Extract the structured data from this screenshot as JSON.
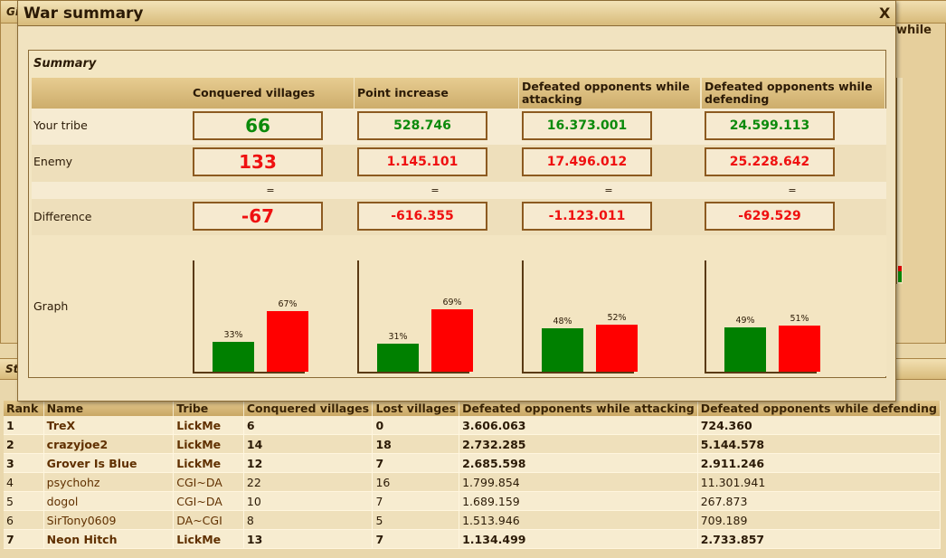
{
  "background_window": {
    "title_fragment": "Gi",
    "header_fragment": "while"
  },
  "stats_panel": {
    "title_fragment": "St",
    "columns": [
      "Rank",
      "Name",
      "Tribe",
      "Conquered villages",
      "Lost villages",
      "Defeated opponents while attacking",
      "Defeated opponents while defending"
    ],
    "rows": [
      {
        "rank": "1",
        "name": "TreX",
        "tribe": "LickMe",
        "conquered": "6",
        "lost": "0",
        "attacking": "3.606.063",
        "defending": "724.360",
        "bold": true
      },
      {
        "rank": "2",
        "name": "crazyjoe2",
        "tribe": "LickMe",
        "conquered": "14",
        "lost": "18",
        "attacking": "2.732.285",
        "defending": "5.144.578",
        "bold": true
      },
      {
        "rank": "3",
        "name": "Grover Is Blue",
        "tribe": "LickMe",
        "conquered": "12",
        "lost": "7",
        "attacking": "2.685.598",
        "defending": "2.911.246",
        "bold": true
      },
      {
        "rank": "4",
        "name": "psychohz",
        "tribe": "CGI~DA",
        "conquered": "22",
        "lost": "16",
        "attacking": "1.799.854",
        "defending": "11.301.941",
        "bold": false
      },
      {
        "rank": "5",
        "name": "dogol",
        "tribe": "CGI~DA",
        "conquered": "10",
        "lost": "7",
        "attacking": "1.689.159",
        "defending": "267.873",
        "bold": false
      },
      {
        "rank": "6",
        "name": "SirTony0609",
        "tribe": "DA~CGI",
        "conquered": "8",
        "lost": "5",
        "attacking": "1.513.946",
        "defending": "709.189",
        "bold": false
      },
      {
        "rank": "7",
        "name": "Neon Hitch",
        "tribe": "LickMe",
        "conquered": "13",
        "lost": "7",
        "attacking": "1.134.499",
        "defending": "2.733.857",
        "bold": true
      }
    ]
  },
  "dialog": {
    "title": "War summary",
    "close_label": "X",
    "summary_label": "Summary",
    "columns": [
      "Conquered villages",
      "Point increase",
      "Defeated opponents while attacking",
      "Defeated opponents while defending"
    ],
    "row_labels": {
      "your_tribe": "Your tribe",
      "enemy": "Enemy",
      "difference": "Difference",
      "graph": "Graph"
    },
    "equals_sign": "=",
    "your_tribe": [
      "66",
      "528.746",
      "16.373.001",
      "24.599.113"
    ],
    "enemy": [
      "133",
      "1.145.101",
      "17.496.012",
      "25.228.642"
    ],
    "difference": [
      "-67",
      "-616.355",
      "-1.123.011",
      "-629.529"
    ],
    "colors": {
      "your_tribe": "#008000",
      "enemy": "#ff0000"
    }
  },
  "chart_data": [
    {
      "type": "bar",
      "categories": [
        "Your tribe",
        "Enemy"
      ],
      "values": [
        33,
        67
      ],
      "data_labels": [
        "33%",
        "67%"
      ],
      "unit": "%",
      "ylim": [
        0,
        100
      ]
    },
    {
      "type": "bar",
      "categories": [
        "Your tribe",
        "Enemy"
      ],
      "values": [
        31,
        69
      ],
      "data_labels": [
        "31%",
        "69%"
      ],
      "unit": "%",
      "ylim": [
        0,
        100
      ]
    },
    {
      "type": "bar",
      "categories": [
        "Your tribe",
        "Enemy"
      ],
      "values": [
        48,
        52
      ],
      "data_labels": [
        "48%",
        "52%"
      ],
      "unit": "%",
      "ylim": [
        0,
        100
      ]
    },
    {
      "type": "bar",
      "categories": [
        "Your tribe",
        "Enemy"
      ],
      "values": [
        49,
        51
      ],
      "data_labels": [
        "49%",
        "51%"
      ],
      "unit": "%",
      "ylim": [
        0,
        100
      ]
    }
  ]
}
